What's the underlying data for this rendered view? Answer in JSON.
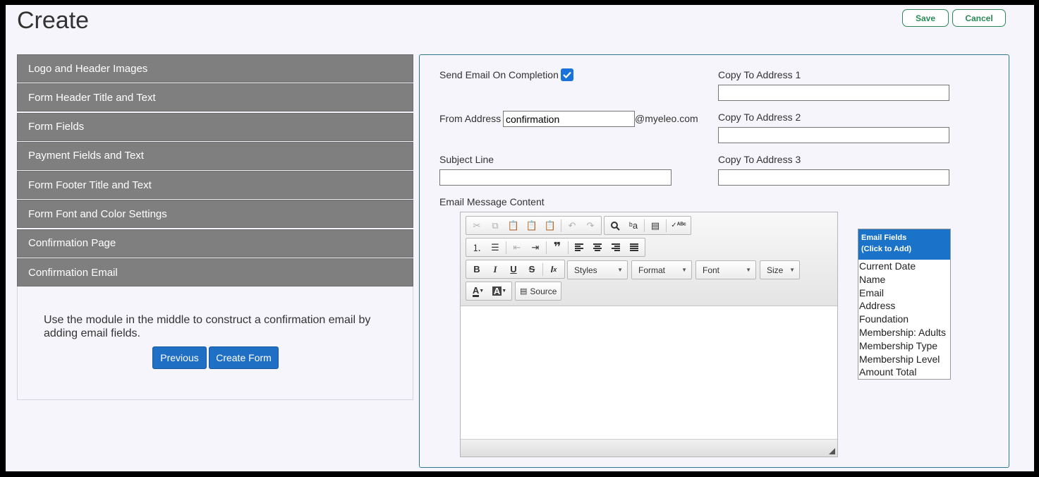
{
  "page": {
    "title": "Create",
    "save_label": "Save",
    "cancel_label": "Cancel"
  },
  "accordion": {
    "items": [
      {
        "label": "Logo and Header Images"
      },
      {
        "label": "Form Header Title and Text"
      },
      {
        "label": "Form Fields"
      },
      {
        "label": "Payment Fields and Text"
      },
      {
        "label": "Form Footer Title and Text"
      },
      {
        "label": "Form Font and Color Settings"
      },
      {
        "label": "Confirmation Page"
      },
      {
        "label": "Confirmation Email"
      }
    ],
    "panel_text": "Use the module in the middle to construct a confirmation email by adding email fields.",
    "previous_label": "Previous",
    "create_form_label": "Create Form"
  },
  "email_settings": {
    "send_email_label": "Send Email On Completion",
    "send_email_checked": true,
    "from_address_label": "From Address",
    "from_address_value": "confirmation",
    "from_domain": "@myeleo.com",
    "subject_label": "Subject Line",
    "subject_value": "",
    "copy1_label": "Copy To Address 1",
    "copy1_value": "",
    "copy2_label": "Copy To Address 2",
    "copy2_value": "",
    "copy3_label": "Copy To Address 3",
    "copy3_value": "",
    "message_label": "Email Message Content"
  },
  "editor": {
    "styles_label": "Styles",
    "format_label": "Format",
    "font_label": "Font",
    "size_label": "Size",
    "source_label": "Source"
  },
  "email_fields": {
    "header_line1": "Email Fields",
    "header_line2": "(Click to Add)",
    "items": [
      "Current Date",
      "Name",
      "Email",
      "Address",
      "Foundation",
      "Membership: Adults",
      "Membership Type",
      "Membership Level",
      "Amount Total"
    ]
  },
  "colors": {
    "accent_blue": "#1f6fc5",
    "accordion_gray": "#7f7f7f",
    "save_green": "#2a8a57",
    "panel_border": "#2c7a8f"
  }
}
